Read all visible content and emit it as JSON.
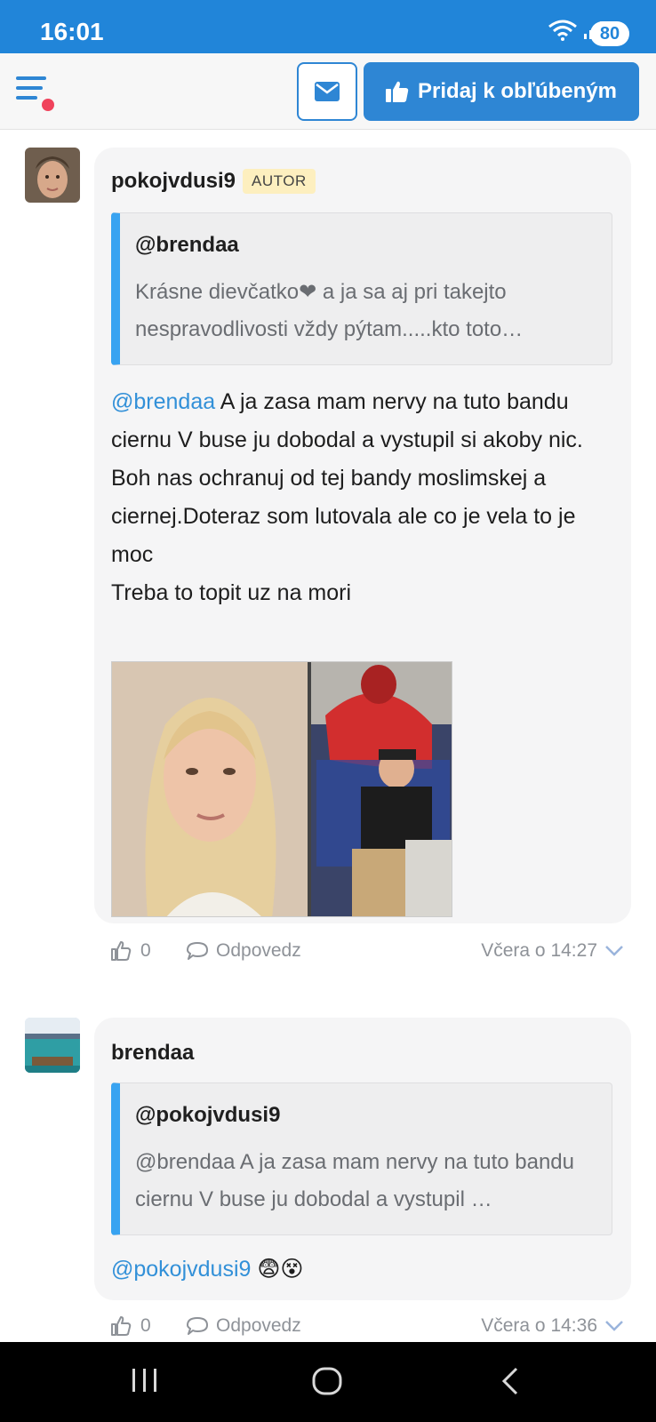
{
  "status_bar": {
    "time": "16:01",
    "battery": "80"
  },
  "header": {
    "favorite_label": "Pridaj k obľúbeným"
  },
  "comments": [
    {
      "author": "pokojvdusi9",
      "badge": "AUTOR",
      "quote_user": "@brendaa",
      "quote_text": "Krásne dievčatko❤ a ja sa aj pri takejto nespravodlivosti vždy pýtam.....kto toto…",
      "mention": "@brendaa",
      "text_after_mention": " A ja zasa mam nervy na tuto bandu ciernu V buse ju dobodal a vystupil si akoby nic.",
      "lines": [
        "Boh nas ochranuj od tej bandy moslimskej a ciernej.Doteraz som lutovala ale co je vela to je moc",
        "Treba to topit uz na mori"
      ],
      "likes": "0",
      "reply_label": "Odpovedz",
      "timestamp": "Včera o 14:27"
    },
    {
      "author": "brendaa",
      "quote_user": "@pokojvdusi9",
      "quote_text": "@brendaa A ja zasa mam nervy na tuto bandu ciernu V buse ju dobodal a vystupil …",
      "mention": "@pokojvdusi9",
      "text_after_mention": " 😨😵",
      "likes": "0",
      "reply_label": "Odpovedz",
      "timestamp": "Včera o 14:36"
    }
  ],
  "colors": {
    "primary": "#2e86d4",
    "status_bar": "#2185d9",
    "quote_border": "#38a3f1",
    "badge_bg": "#fdefbf",
    "notification_dot": "#f0435c",
    "mention": "#3290d8"
  },
  "icons": [
    "wifi-icon",
    "signal-icon",
    "menu-icon",
    "mail-icon",
    "thumbs-up-icon",
    "chat-bubble-icon",
    "chevron-down-icon",
    "recents-icon",
    "home-icon",
    "back-icon"
  ]
}
